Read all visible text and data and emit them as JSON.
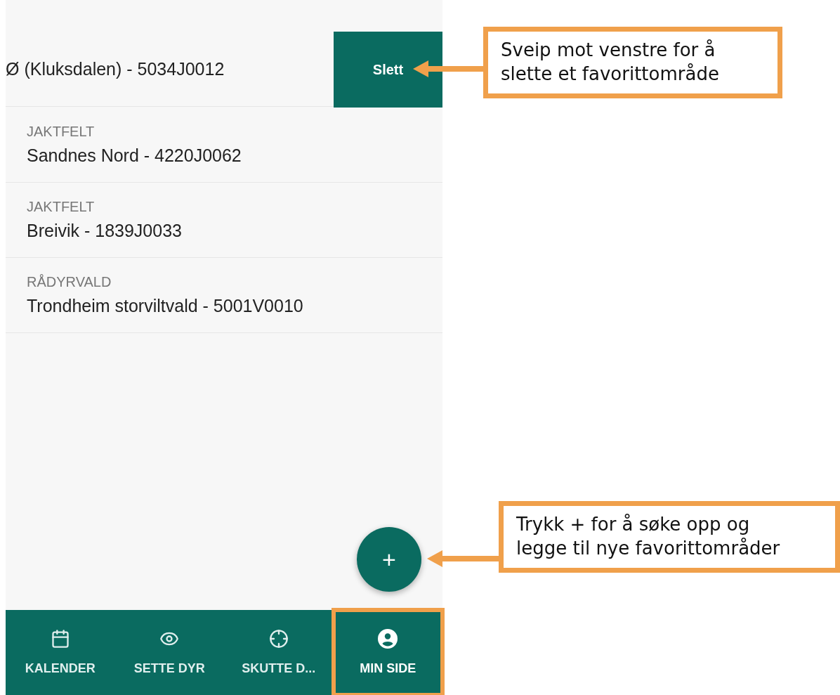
{
  "favorites": [
    {
      "name": "Ø (Kluksdalen) - 5034J0012",
      "swiped": true,
      "action": "Slett"
    },
    {
      "category": "JAKTFELT",
      "name": "Sandnes Nord - 4220J0062",
      "swiped": false
    },
    {
      "category": "JAKTFELT",
      "name": "Breivik - 1839J0033",
      "swiped": false
    },
    {
      "category": "RÅDYRVALD",
      "name": "Trondheim storviltvald - 5001V0010",
      "swiped": false
    }
  ],
  "fab": {
    "label": "+"
  },
  "bottom_nav": [
    {
      "label": "KALENDER",
      "kind": "calendar",
      "selected": false
    },
    {
      "label": "SETTE DYR",
      "kind": "eye",
      "selected": false
    },
    {
      "label": "SKUTTE D...",
      "kind": "target",
      "selected": false
    },
    {
      "label": "MIN SIDE",
      "kind": "account",
      "selected": true
    }
  ],
  "callouts": [
    {
      "lines": [
        "Sveip mot venstre for å",
        "slette et favorittområde"
      ],
      "kind": "delete"
    },
    {
      "lines": [
        "Trykk + for å søke opp og",
        "legge til nye favorittområder"
      ],
      "kind": "fab"
    }
  ]
}
